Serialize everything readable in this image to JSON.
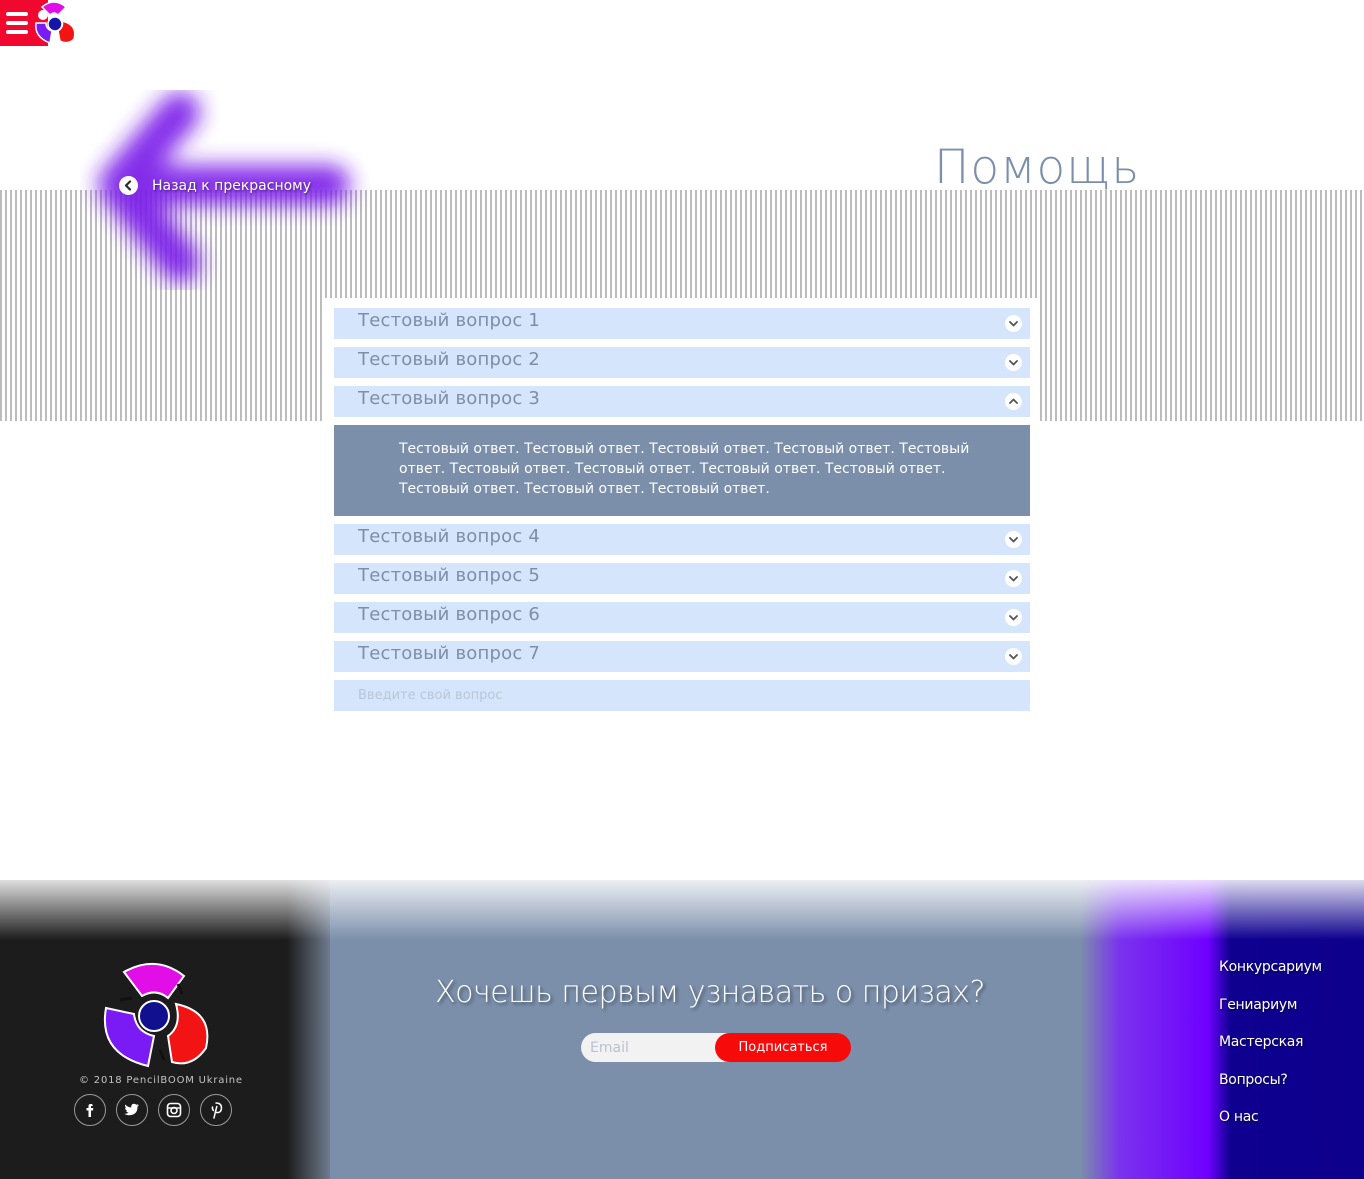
{
  "header": {
    "menu_icon": "hamburger-icon",
    "logo": "pencilboom-logo",
    "back_label": "Назад к прекрасному",
    "back_icon": "chevron-left-icon",
    "page_title": "Помощь"
  },
  "faq": {
    "items": [
      {
        "question": "Тестовый вопрос 1",
        "expanded": false
      },
      {
        "question": "Тестовый вопрос 2",
        "expanded": false
      },
      {
        "question": "Тестовый вопрос 3",
        "expanded": true
      },
      {
        "question": "Тестовый вопрос 4",
        "expanded": false
      },
      {
        "question": "Тестовый вопрос 5",
        "expanded": false
      },
      {
        "question": "Тестовый вопрос 6",
        "expanded": false
      },
      {
        "question": "Тестовый вопрос 7",
        "expanded": false
      }
    ],
    "answer": "Тестовый ответ. Тестовый ответ. Тестовый ответ. Тестовый ответ. Тестовый ответ. Тестовый ответ. Тестовый ответ. Тестовый ответ. Тестовый ответ. Тестовый ответ. Тестовый ответ. Тестовый ответ.",
    "ask_placeholder": "Введите свой вопрос"
  },
  "footer": {
    "copyright": "© 2018 PencilBOOM Ukraine",
    "socials": [
      "facebook-icon",
      "twitter-icon",
      "instagram-icon",
      "pinterest-icon"
    ],
    "promo_title": "Хочешь первым узнавать о призах?",
    "email_placeholder": "Email",
    "subscribe_label": "Подписаться",
    "nav": [
      "Конкурсариум",
      "Гениариум",
      "Мастерская",
      "Вопросы?",
      "О нас"
    ]
  },
  "colors": {
    "accent_red": "#f70a0a",
    "faq_item_bg": "#d5e6fc",
    "slate": "#7b8fab",
    "violet": "#6f00ff",
    "navy": "#0d008c"
  }
}
